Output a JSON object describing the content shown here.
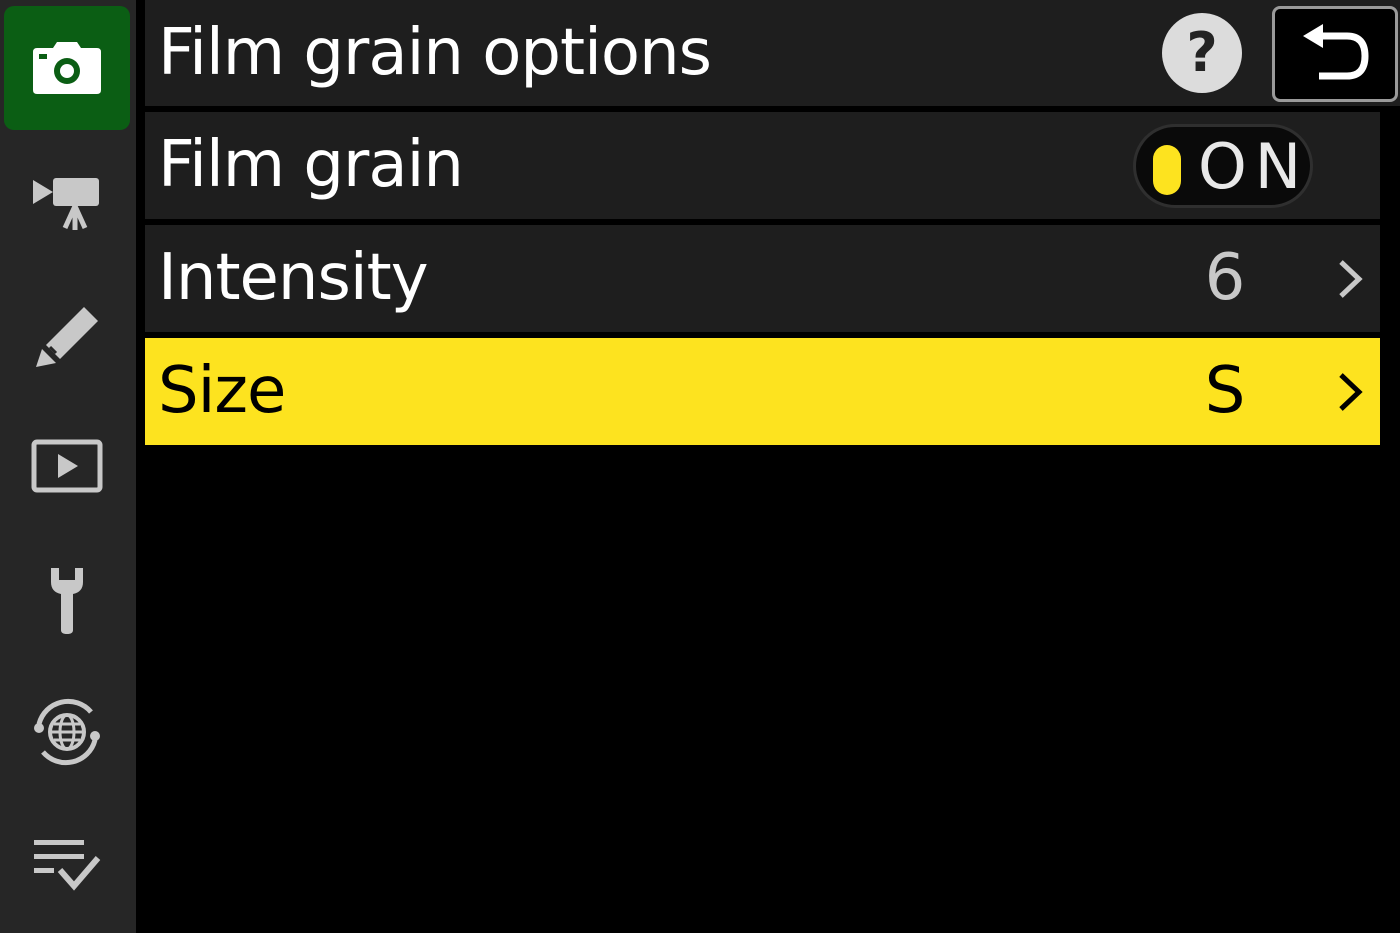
{
  "sidebar": {
    "items": [
      {
        "icon": "camera-icon",
        "active": true
      },
      {
        "icon": "video-camera-icon",
        "active": false
      },
      {
        "icon": "pencil-icon",
        "active": false
      },
      {
        "icon": "playback-icon",
        "active": false
      },
      {
        "icon": "wrench-icon",
        "active": false
      },
      {
        "icon": "network-globe-icon",
        "active": false
      },
      {
        "icon": "my-menu-icon",
        "active": false
      }
    ]
  },
  "header": {
    "title": "Film grain options",
    "help_label": "?",
    "back_icon": "return-arrow-icon"
  },
  "menu": {
    "rows": [
      {
        "label": "Film grain",
        "toggle_label": "ON",
        "toggle_state": "on"
      },
      {
        "label": "Intensity",
        "value": "6"
      },
      {
        "label": "Size",
        "value": "S",
        "selected": true
      }
    ]
  },
  "colors": {
    "accent_yellow": "#fde31f",
    "active_tab_green": "#0b5e14",
    "sidebar_bg": "#262626",
    "row_bg": "#1e1e1e"
  }
}
